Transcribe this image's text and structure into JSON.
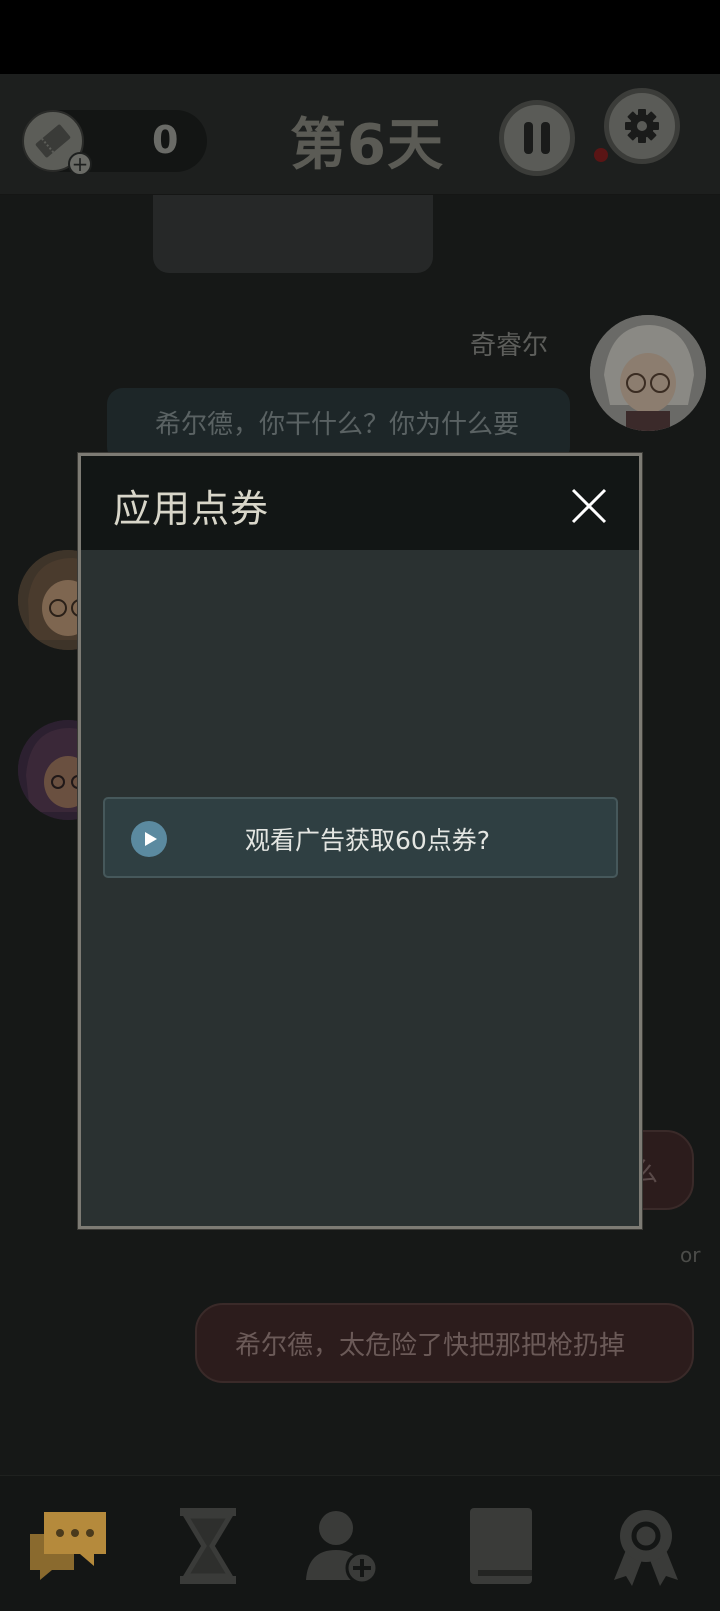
{
  "header": {
    "ticket_count": "0",
    "day_title": "第6天"
  },
  "chat": {
    "sender_name": "奇睿尔",
    "message_text": "希尔德，你干什么？你为什么要",
    "choice_partial_text": "么",
    "separator": "or",
    "choice_text": "希尔德，太危险了快把那把枪扔掉"
  },
  "dialog": {
    "title": "应用点券",
    "ad_button_label": "观看广告获取60点券?"
  },
  "nav": {
    "items": [
      "chat-icon",
      "hourglass-icon",
      "add-user-icon",
      "book-icon",
      "medal-icon"
    ]
  },
  "colors": {
    "dialog_border": "#7d7b74",
    "ad_button_bg": "#2f3f42",
    "play_icon": "#5b8aa0"
  }
}
